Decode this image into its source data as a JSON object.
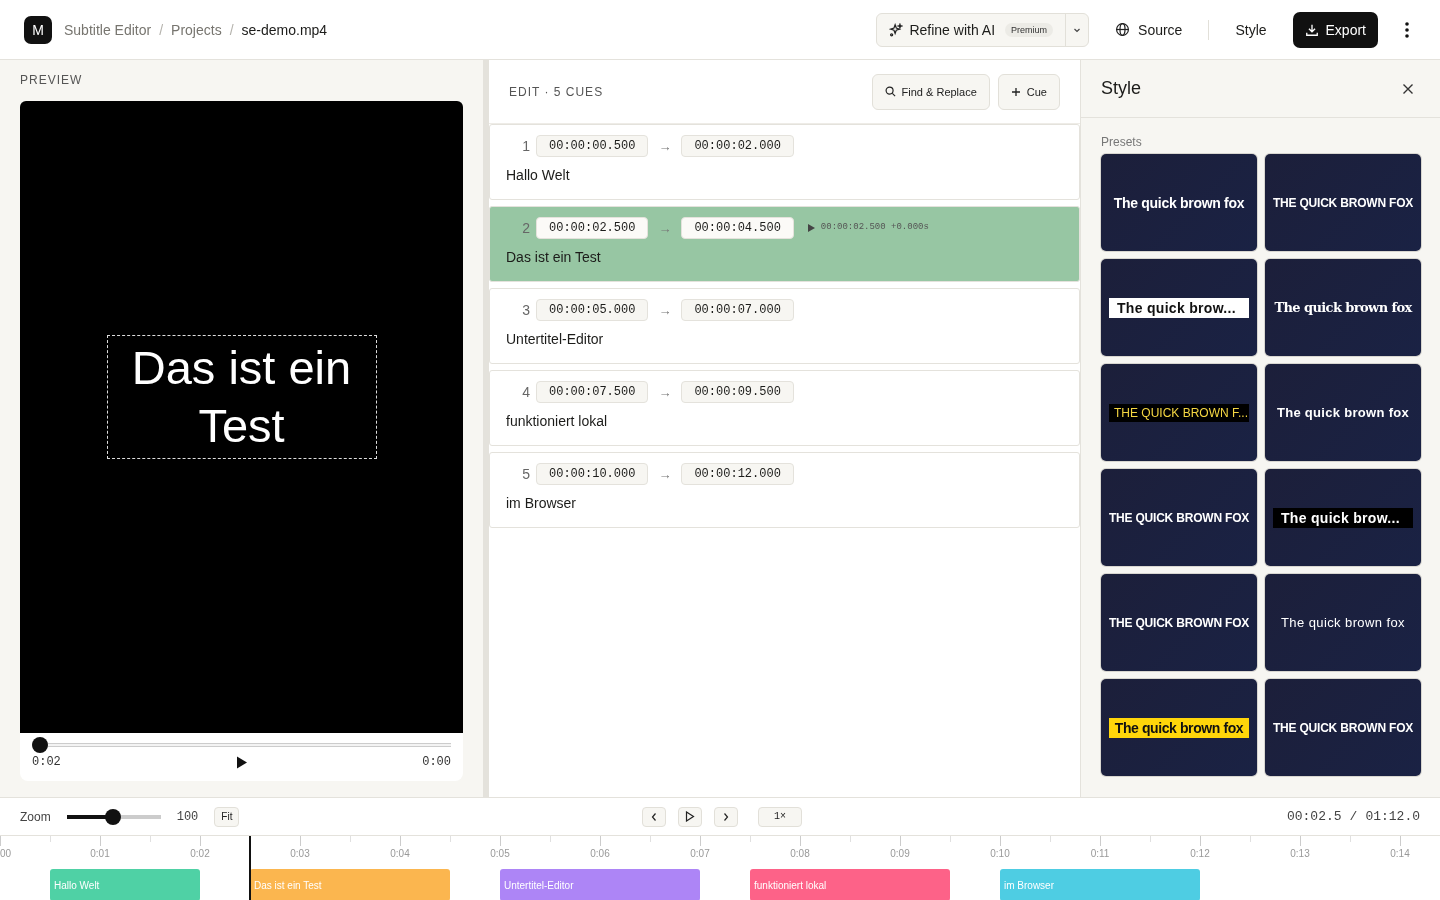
{
  "header": {
    "logo": "M",
    "breadcrumbs": [
      {
        "label": "Subtitle Editor",
        "current": false
      },
      {
        "label": "Projects",
        "current": false
      },
      {
        "label": "se-demo.mp4",
        "current": true
      }
    ],
    "separator": "/",
    "refine": {
      "label": "Refine with AI",
      "badge": "Premium"
    },
    "source": "Source",
    "style": "Style",
    "export": "Export"
  },
  "preview": {
    "heading": "PREVIEW",
    "subtitle": "Das ist ein Test",
    "elapsed": "0:02",
    "remaining": "0:00",
    "level": 0.02
  },
  "editor": {
    "heading": "EDIT · 5 CUES",
    "find": "Find & Replace",
    "add": "Cue",
    "cues": [
      {
        "index": "1",
        "start": "00:00:00.500",
        "end": "00:00:02.000",
        "arrow": "→",
        "text": "Hallo Welt",
        "selected": false
      },
      {
        "index": "2",
        "start": "00:00:02.500",
        "end": "00:00:04.500",
        "arrow": "→",
        "text": "Das ist ein Test",
        "selected": true,
        "position": "00:00:02.500 +0.000s"
      },
      {
        "index": "3",
        "start": "00:00:05.000",
        "end": "00:00:07.000",
        "arrow": "→",
        "text": "Untertitel-Editor",
        "selected": false
      },
      {
        "index": "4",
        "start": "00:00:07.500",
        "end": "00:00:09.500",
        "arrow": "→",
        "text": "funktioniert lokal",
        "selected": false
      },
      {
        "index": "5",
        "start": "00:00:10.000",
        "end": "00:00:12.000",
        "arrow": "→",
        "text": "im Browser",
        "selected": false
      }
    ]
  },
  "style_panel": {
    "title": "Style",
    "presets_label": "Presets",
    "presets": [
      {
        "kind": "bold",
        "text": "The quick brown fox"
      },
      {
        "kind": "caps",
        "text": "THE QUICK BROWN FOX"
      },
      {
        "kind": "white-box",
        "text": "The quick brow..."
      },
      {
        "kind": "serif",
        "text": "The quick brown fox"
      },
      {
        "kind": "yellow-on-black",
        "text": "THE QUICK BROWN F..."
      },
      {
        "kind": "spaced",
        "text": "The quick brown fox"
      },
      {
        "kind": "caps",
        "text": "THE QUICK BROWN FOX"
      },
      {
        "kind": "black-box",
        "text": "The quick brow..."
      },
      {
        "kind": "caps",
        "text": "THE QUICK BROWN FOX"
      },
      {
        "kind": "light",
        "text": "The quick brown fox"
      },
      {
        "kind": "yellow-box",
        "text": "The quick brown fox"
      },
      {
        "kind": "caps",
        "text": "THE QUICK BROWN FOX"
      }
    ]
  },
  "toolbar": {
    "zoom_label": "Zoom",
    "level": 0.49,
    "zoom_value": "100",
    "fit": "Fit",
    "speed": "1×",
    "current": "00:02.5",
    "separator": "/",
    "duration": "01:12.0"
  },
  "timeline": {
    "ticks": [
      "00",
      "0:01",
      "0:02",
      "0:03",
      "0:04",
      "0:05",
      "0:06",
      "0:07",
      "0:08",
      "0:09",
      "0:10",
      "0:11",
      "0:12",
      "0:13",
      "0:14"
    ],
    "clips": [
      {
        "label": "Hallo Welt",
        "color": "#4fd1a5"
      },
      {
        "label": "Das ist ein Test",
        "color": "#fbb64f"
      },
      {
        "label": "Untertitel-Editor",
        "color": "#ad85f6"
      },
      {
        "label": "funktioniert lokal",
        "color": "#fd6288"
      },
      {
        "label": "im Browser",
        "color": "#4ecde3"
      }
    ]
  }
}
